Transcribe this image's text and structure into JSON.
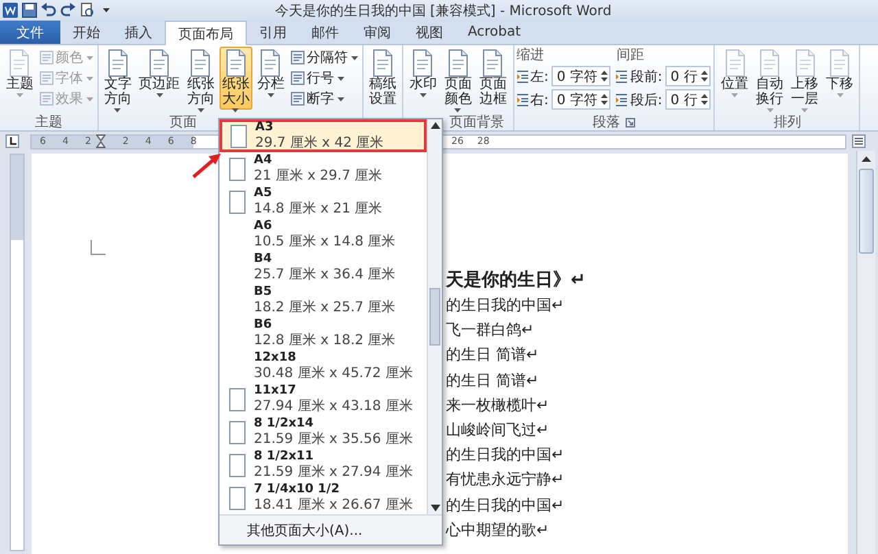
{
  "title_bar": {
    "title": "今天是你的生日我的中国 [兼容模式] - Microsoft Word"
  },
  "tabs": [
    {
      "label": "文件",
      "kind": "file",
      "selected": false
    },
    {
      "label": "开始",
      "kind": "tab",
      "selected": false
    },
    {
      "label": "插入",
      "kind": "tab",
      "selected": false
    },
    {
      "label": "页面布局",
      "kind": "tab",
      "selected": true
    },
    {
      "label": "引用",
      "kind": "tab",
      "selected": false
    },
    {
      "label": "邮件",
      "kind": "tab",
      "selected": false
    },
    {
      "label": "审阅",
      "kind": "tab",
      "selected": false
    },
    {
      "label": "视图",
      "kind": "tab",
      "selected": false
    },
    {
      "label": "Acrobat",
      "kind": "tab",
      "selected": false
    }
  ],
  "ribbon": {
    "groups": [
      {
        "label": "主题",
        "kind": "buttons",
        "disabled": true,
        "items": [
          {
            "kind": "large",
            "label": "主题",
            "caret": true
          },
          {
            "kind": "stack",
            "items": [
              {
                "label": "颜色",
                "caret": true
              },
              {
                "label": "字体",
                "caret": true
              },
              {
                "label": "效果",
                "caret": true
              }
            ]
          }
        ]
      },
      {
        "label": "页面",
        "kind": "buttons",
        "disabled": false,
        "items": [
          {
            "kind": "large",
            "label": "文字方向",
            "caret": true,
            "pressed": false
          },
          {
            "kind": "large",
            "label": "页边距",
            "caret": true,
            "pressed": false
          },
          {
            "kind": "large",
            "label": "纸张方向",
            "caret": true,
            "pressed": false
          },
          {
            "kind": "large",
            "label": "纸张大小",
            "caret": true,
            "pressed": true
          },
          {
            "kind": "large",
            "label": "分栏",
            "caret": true,
            "pressed": false
          },
          {
            "kind": "stack",
            "items": [
              {
                "label": "分隔符",
                "caret": true
              },
              {
                "label": "行号",
                "caret": true
              },
              {
                "label": "断字",
                "caret": true
              }
            ]
          }
        ]
      },
      {
        "kind": "buttons",
        "disabled": false,
        "items": [
          {
            "kind": "large",
            "label": "稿纸设置",
            "caret": false
          }
        ]
      },
      {
        "label": "页面背景",
        "kind": "buttons",
        "disabled": false,
        "items": [
          {
            "kind": "large",
            "label": "水印",
            "caret": true
          },
          {
            "kind": "large",
            "label": "页面颜色",
            "caret": true
          },
          {
            "kind": "large",
            "label": "页面边框",
            "caret": false
          }
        ]
      },
      {
        "label": "段落",
        "kind": "paragraph",
        "launcher": true,
        "columns": [
          {
            "heading": "缩进",
            "fields": [
              {
                "label": "左:",
                "value": "0 字符"
              },
              {
                "label": "右:",
                "value": "0 字符"
              }
            ]
          },
          {
            "heading": "间距",
            "fields": [
              {
                "label": "段前:",
                "value": "0 行"
              },
              {
                "label": "段后:",
                "value": "0 行"
              }
            ]
          }
        ]
      },
      {
        "label": "排列",
        "kind": "buttons",
        "disabled": true,
        "items": [
          {
            "kind": "large",
            "label": "位置",
            "caret": true
          },
          {
            "kind": "large",
            "label": "自动换行",
            "caret": true
          },
          {
            "kind": "large",
            "label": "上移一层",
            "caret": true
          },
          {
            "kind": "large",
            "label": "下移",
            "caret": true
          }
        ]
      }
    ]
  },
  "ruler": {
    "left_numbers": [
      "6",
      "4",
      "2",
      "2",
      "4",
      "6",
      "8"
    ],
    "right_numbers": [
      "26",
      "28"
    ]
  },
  "document": {
    "title": "天是你的生日》↵",
    "lines": [
      "的生日我的中国↵",
      "飞一群白鸽↵",
      "的生日 简谱↵",
      "的生日 简谱↵",
      "来一枚橄榄叶↵",
      "山峻岭间飞过↵",
      "的生日我的中国↵",
      "有忧患永远宁静↵",
      "的生日我的中国↵",
      "心中期望的歌↵"
    ]
  },
  "paper_size_menu": {
    "items": [
      {
        "name": "A3",
        "size": "29.7 厘米 x 42 厘米",
        "preview": true,
        "selected": true
      },
      {
        "name": "A4",
        "size": "21 厘米 x 29.7 厘米",
        "preview": true,
        "selected": false
      },
      {
        "name": "A5",
        "size": "14.8 厘米 x 21 厘米",
        "preview": true,
        "selected": false
      },
      {
        "name": "A6",
        "size": "10.5 厘米 x 14.8 厘米",
        "preview": false,
        "selected": false
      },
      {
        "name": "B4",
        "size": "25.7 厘米 x 36.4 厘米",
        "preview": false,
        "selected": false
      },
      {
        "name": "B5",
        "size": "18.2 厘米 x 25.7 厘米",
        "preview": false,
        "selected": false
      },
      {
        "name": "B6",
        "size": "12.8 厘米 x 18.2 厘米",
        "preview": false,
        "selected": false
      },
      {
        "name": "12x18",
        "size": "30.48 厘米 x 45.72 厘米",
        "preview": false,
        "selected": false
      },
      {
        "name": "11x17",
        "size": "27.94 厘米 x 43.18 厘米",
        "preview": true,
        "selected": false
      },
      {
        "name": "8 1/2x14",
        "size": "21.59 厘米 x 35.56 厘米",
        "preview": true,
        "selected": false
      },
      {
        "name": "8 1/2x11",
        "size": "21.59 厘米 x 27.94 厘米",
        "preview": true,
        "selected": false
      },
      {
        "name": "7 1/4x10 1/2",
        "size": "18.41 厘米 x 26.67 厘米",
        "preview": true,
        "selected": false
      }
    ],
    "footer": "其他页面大小(A)..."
  }
}
